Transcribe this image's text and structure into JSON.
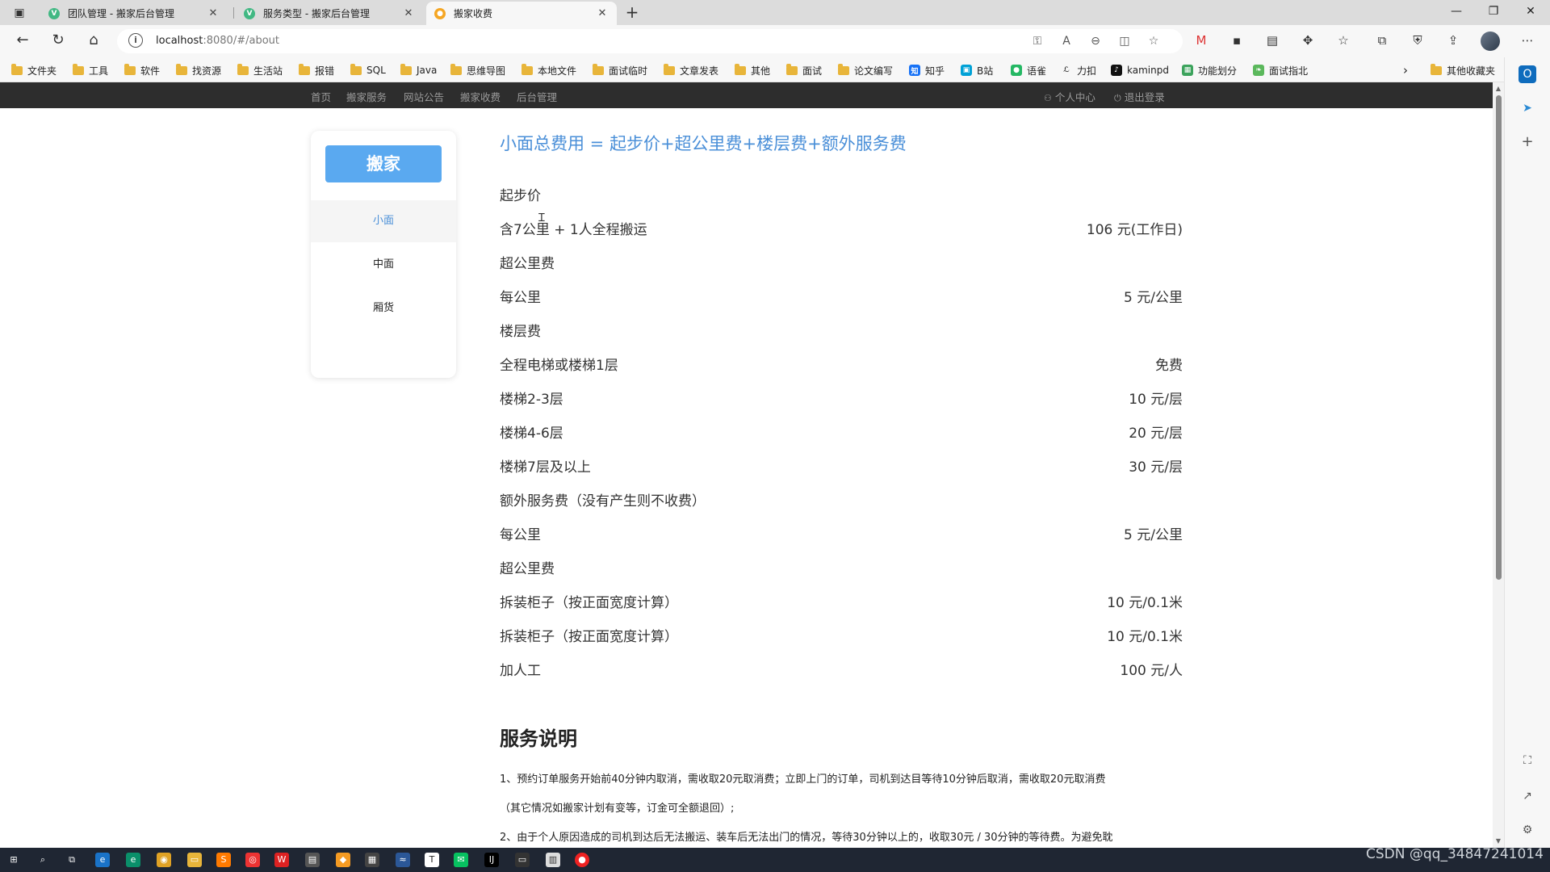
{
  "browser": {
    "tabs": [
      {
        "title": "团队管理 - 搬家后台管理",
        "icon": "vue-icon",
        "active": false
      },
      {
        "title": "服务类型 - 搬家后台管理",
        "icon": "vue-icon",
        "active": false
      },
      {
        "title": "搬家收费",
        "icon": "site-icon",
        "active": true
      }
    ],
    "address": {
      "host": "localhost",
      "rest": ":8080/#/about"
    },
    "bookmarks": [
      "文件夹",
      "工具",
      "软件",
      "找资源",
      "生活站",
      "报错",
      "SQL",
      "Java",
      "思维导图",
      "本地文件",
      "面试临时",
      "文章发表",
      "其他",
      "面试",
      "论文编写",
      "知乎",
      "B站",
      "语雀",
      "力扣",
      "kaminpd",
      "功能划分",
      "面试指北",
      "其他收藏夹"
    ]
  },
  "topnav": {
    "items": [
      "首页",
      "搬家服务",
      "网站公告",
      "搬家收费",
      "后台管理"
    ],
    "user_center": "个人中心",
    "logout": "退出登录"
  },
  "sidebar": {
    "brand": "搬家",
    "items": [
      "小面",
      "中面",
      "厢货"
    ],
    "active_index": 0
  },
  "pricing": {
    "formula": "小面总费用 = 起步价+超公里费+楼层费+额外服务费",
    "rows": [
      {
        "label": "起步价",
        "value": ""
      },
      {
        "label": "含7公里 + 1人全程搬运",
        "value": "106 元(工作日)"
      },
      {
        "label": "超公里费",
        "value": ""
      },
      {
        "label": "每公里",
        "value": "5 元/公里"
      },
      {
        "label": "楼层费",
        "value": ""
      },
      {
        "label": "全程电梯或楼梯1层",
        "value": "免费"
      },
      {
        "label": "楼梯2-3层",
        "value": "10 元/层"
      },
      {
        "label": "楼梯4-6层",
        "value": "20 元/层"
      },
      {
        "label": "楼梯7层及以上",
        "value": "30 元/层"
      },
      {
        "label": "额外服务费（没有产生则不收费）",
        "value": ""
      },
      {
        "label": "每公里",
        "value": "5 元/公里"
      },
      {
        "label": "超公里费",
        "value": ""
      },
      {
        "label": "拆装柜子（按正面宽度计算）",
        "value": "10 元/0.1米"
      },
      {
        "label": "拆装柜子（按正面宽度计算）",
        "value": "10 元/0.1米"
      },
      {
        "label": "加人工",
        "value": "100 元/人"
      }
    ]
  },
  "service": {
    "title": "服务说明",
    "paragraphs": [
      "1、预约订单服务开始前40分钟内取消，需收取20元取消费；立即上门的订单，司机到达目等待10分钟后取消，需收取20元取消费",
      "（其它情况如搬家计划有变等，订金可全额退回）;",
      "2、由于个人原因造成的司机到达后无法搬运、装车后无法出门的情况，等待30分钟以上的，收取30元 / 30分钟的等待费。为避免耽"
    ]
  },
  "watermark": "CSDN @qq_34847241014",
  "colors": {
    "accent": "#4a8fd8",
    "brand_button": "#5aa9f0",
    "nav_bg": "#2d2d2d"
  }
}
